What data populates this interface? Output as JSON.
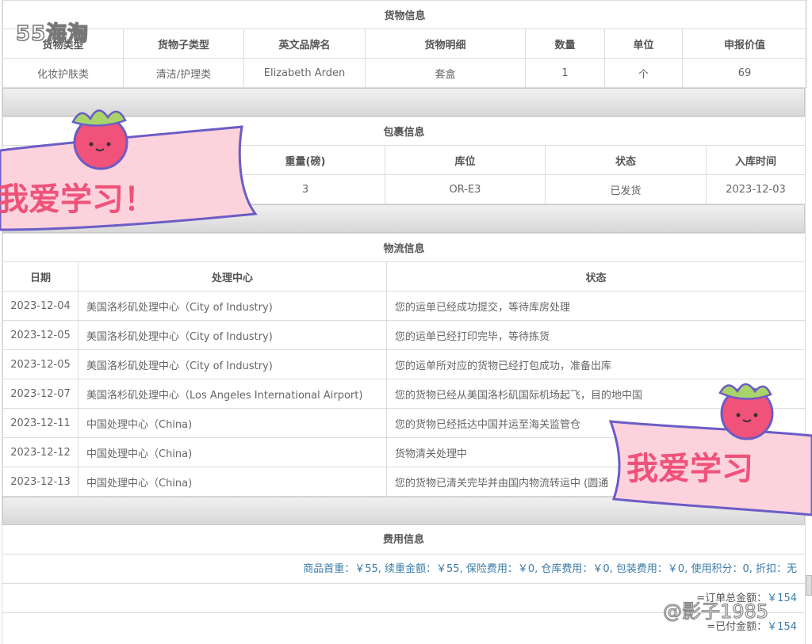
{
  "goods": {
    "title": "货物信息",
    "headers": [
      "货物类型",
      "货物子类型",
      "英文品牌名",
      "货物明细",
      "数量",
      "单位",
      "申报价值"
    ],
    "rows": [
      [
        "化妆护肤类",
        "清洁/护理类",
        "Elizabeth Arden",
        "套盒",
        "1",
        "个",
        "69"
      ]
    ]
  },
  "package": {
    "title": "包裹信息",
    "headers": [
      "",
      "重量(磅)",
      "库位",
      "状态",
      "入库时间"
    ],
    "rows": [
      [
        "",
        "3",
        "OR-E3",
        "已发货",
        "2023-12-03"
      ]
    ]
  },
  "logistics": {
    "title": "物流信息",
    "headers": [
      "日期",
      "处理中心",
      "状态"
    ],
    "rows": [
      [
        "2023-12-04",
        "美国洛杉矶处理中心（City of Industry)",
        "您的运单已经成功提交，等待库房处理"
      ],
      [
        "2023-12-05",
        "美国洛杉矶处理中心（City of Industry)",
        "您的运单已经打印完毕，等待拣货"
      ],
      [
        "2023-12-05",
        "美国洛杉矶处理中心（City of Industry)",
        "您的运单所对应的货物已经打包成功，准备出库"
      ],
      [
        "2023-12-07",
        "美国洛杉矶处理中心（Los Angeles International Airport)",
        "您的货物已经从美国洛杉矶国际机场起飞，目的地中国"
      ],
      [
        "2023-12-11",
        "中国处理中心（China)",
        "您的货物已经抵达中国并运至海关监管仓"
      ],
      [
        "2023-12-12",
        "中国处理中心（China)",
        "货物清关处理中"
      ],
      [
        "2023-12-13",
        "中国处理中心（China)",
        "您的货物已清关完毕并由国内物流转运中 (圆通"
      ]
    ]
  },
  "fees": {
    "title": "费用信息",
    "detail": "商品首重：￥55, 续重金额：￥55, 保险费用：￥0, 仓库费用：￥0, 包装费用：￥0, 使用积分：0, 折扣：无",
    "total_label": "=订单总金额：",
    "total_value": "￥154",
    "paid_label": "=已付金额：",
    "paid_value": "￥154"
  },
  "decorations": {
    "watermark_top": "55海淘",
    "watermark_bottom": "@影子1985",
    "sticker_text": "我爱学习！",
    "sticker_text2": "我爱学习"
  }
}
